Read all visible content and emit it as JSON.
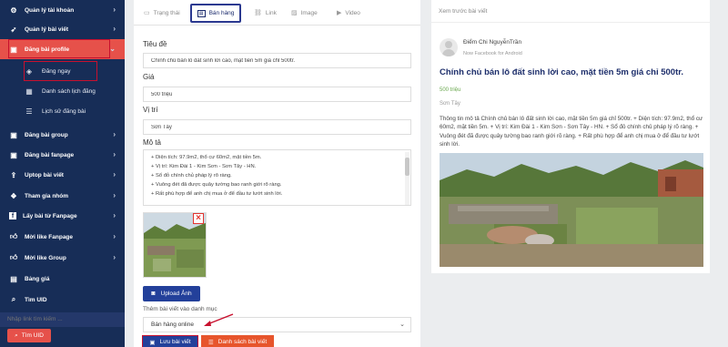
{
  "sidebar": {
    "items": [
      {
        "label": "Quản lý tài khoản",
        "icon": "gear-icon"
      },
      {
        "label": "Quản lý bài viết",
        "icon": "rocket-icon"
      },
      {
        "label": "Đăng bài profile",
        "icon": "calendar-icon",
        "active": true
      },
      {
        "label": "Đăng bài group",
        "icon": "calendar-icon"
      },
      {
        "label": "Đăng bài fanpage",
        "icon": "calendar-icon"
      },
      {
        "label": "Uptop bài viết",
        "icon": "upload-icon"
      },
      {
        "label": "Tham gia nhóm",
        "icon": "group-icon"
      },
      {
        "label": "Lấy bài từ Fanpage",
        "icon": "facebook-icon"
      },
      {
        "label": "Mời like Fanpage",
        "icon": "thumbs-up-icon"
      },
      {
        "label": "Mời like Group",
        "icon": "thumbs-up-icon"
      },
      {
        "label": "Bảng giá",
        "icon": "price-table-icon"
      },
      {
        "label": "Tìm UID",
        "icon": "search-icon"
      }
    ],
    "sub_items": [
      {
        "label": "Đăng ngay",
        "icon": "tag-icon"
      },
      {
        "label": "Danh sách lịch đăng",
        "icon": "calendar-grid-icon"
      },
      {
        "label": "Lịch sử đăng bài",
        "icon": "list-icon"
      }
    ],
    "search_placeholder": "Nhập link tìm kiếm ...",
    "search_button": "Tìm UID",
    "active_color": "#e6514a",
    "bg_color": "#172d57"
  },
  "tabs": [
    {
      "label": "Trạng thái",
      "icon": "status-icon"
    },
    {
      "label": "Bán hàng",
      "icon": "shop-icon",
      "active": true
    },
    {
      "label": "Link",
      "icon": "link-icon"
    },
    {
      "label": "Image",
      "icon": "image-icon"
    },
    {
      "label": "Video",
      "icon": "video-icon"
    }
  ],
  "form": {
    "title_label": "Tiêu đề",
    "title_value": "Chính chủ bán lô đất sinh lời cao, mặt tiền 5m giá chỉ 500tr.",
    "price_label": "Giá",
    "price_value": "500 triệu",
    "location_label": "Vị trí",
    "location_value": "Sơn Tây",
    "desc_label": "Mô tả",
    "desc_lines": [
      "+ Diện tích: 97.9m2, thổ cư 60m2, mặt tiền 5m.",
      "+ Vị trí: Kim Đài 1 - Kim Sơn - Sơn Tây - HN.",
      "+ Sổ đỏ chính chủ pháp lý rõ ràng.",
      "+ Vuông đét đã được quây tường bao ranh giới rõ ràng.",
      "+ Rất phù hợp để anh chị mua ở để đầu tư lướt sinh lời."
    ],
    "upload_button": "Upload Ảnh",
    "category_label": "Thêm bài viết vào danh mục",
    "category_value": "Bán hàng online",
    "save_button": "Lưu bài viết",
    "list_button": "Danh sách bài viết"
  },
  "preview": {
    "header": "Xem trước bài viết",
    "author": "Điểm Chi NguyễnTrần",
    "meta": "Now  Facebook for Android",
    "title": "Chính chủ bán lô đất sinh lời cao, mặt tiền 5m giá chỉ 500tr.",
    "price": "500 triệu",
    "location": "Sơn Tây",
    "description": "Thông tin mô tả Chính chủ bán lô đất sinh lời cao, mặt tiền 5m giá chỉ 500tr. + Diện tích: 97.9m2, thổ cư 60m2, mặt tiền 5m. + Vị trí: Kim Đài 1 - Kim Sơn - Sơn Tây - HN. + Sổ đỏ chính chủ pháp lý rõ ràng. + Vuông đét đã được quây tường bao ranh giới rõ ràng. + Rất phù hợp để anh chị mua ở để đầu tư lướt sinh lời."
  }
}
